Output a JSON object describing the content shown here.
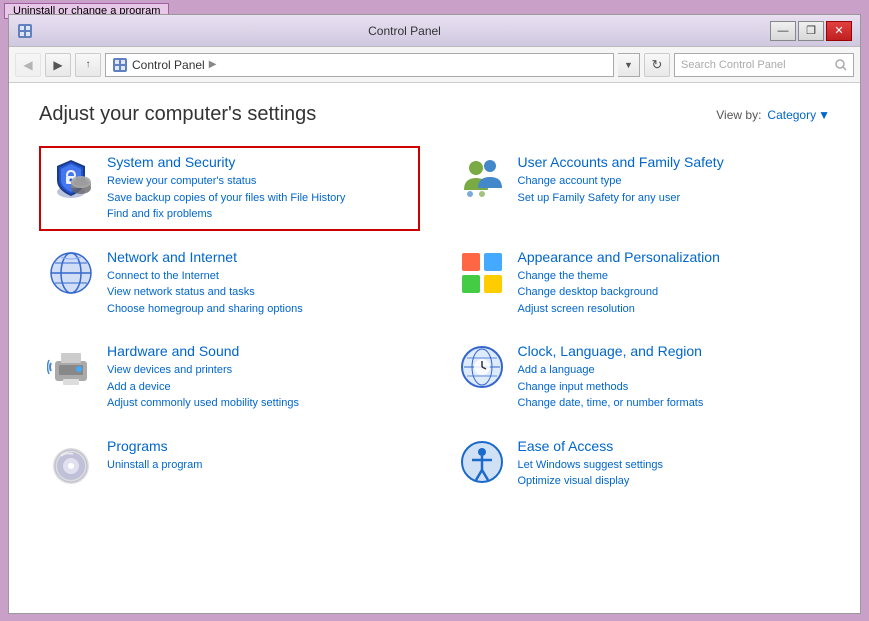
{
  "taskbar": {
    "item": "Uninstall or change a program"
  },
  "window": {
    "title": "Control Panel",
    "controls": {
      "minimize": "—",
      "restore": "❐",
      "close": "✕"
    }
  },
  "addressbar": {
    "back_tooltip": "Back",
    "forward_tooltip": "Forward",
    "up_tooltip": "Up",
    "path": "Control Panel",
    "path_separator": "▶",
    "search_placeholder": "Search Control Panel",
    "refresh_symbol": "↻",
    "dropdown_symbol": "▼"
  },
  "content": {
    "page_title": "Adjust your computer's settings",
    "view_by_label": "View by:",
    "view_by_value": "Category",
    "panels": [
      {
        "id": "system-security",
        "title": "System and Security",
        "highlighted": true,
        "links": [
          "Review your computer's status",
          "Save backup copies of your files with File History",
          "Find and fix problems"
        ]
      },
      {
        "id": "user-accounts",
        "title": "User Accounts and Family Safety",
        "highlighted": false,
        "links": [
          "Change account type",
          "Set up Family Safety for any user"
        ]
      },
      {
        "id": "network-internet",
        "title": "Network and Internet",
        "highlighted": false,
        "links": [
          "Connect to the Internet",
          "View network status and tasks",
          "Choose homegroup and sharing options"
        ]
      },
      {
        "id": "appearance",
        "title": "Appearance and Personalization",
        "highlighted": false,
        "links": [
          "Change the theme",
          "Change desktop background",
          "Adjust screen resolution"
        ]
      },
      {
        "id": "hardware-sound",
        "title": "Hardware and Sound",
        "highlighted": false,
        "links": [
          "View devices and printers",
          "Add a device",
          "Adjust commonly used mobility settings"
        ]
      },
      {
        "id": "clock-language",
        "title": "Clock, Language, and Region",
        "highlighted": false,
        "links": [
          "Add a language",
          "Change input methods",
          "Change date, time, or number formats"
        ]
      },
      {
        "id": "programs",
        "title": "Programs",
        "highlighted": false,
        "links": [
          "Uninstall a program"
        ]
      },
      {
        "id": "ease-access",
        "title": "Ease of Access",
        "highlighted": false,
        "links": [
          "Let Windows suggest settings",
          "Optimize visual display"
        ]
      }
    ]
  }
}
